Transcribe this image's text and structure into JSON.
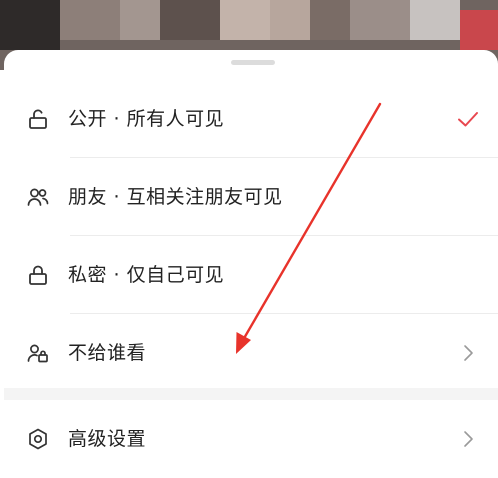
{
  "sheet": {
    "privacy_options": [
      {
        "label": "公开 · 所有人可见",
        "icon": "unlocked-icon",
        "selected": true
      },
      {
        "label": "朋友 · 互相关注朋友可见",
        "icon": "friends-icon",
        "selected": false
      },
      {
        "label": "私密 · 仅自己可见",
        "icon": "locked-icon",
        "selected": false
      },
      {
        "label": "不给谁看",
        "icon": "user-blocked-icon",
        "selected": false,
        "has_submenu": true
      }
    ],
    "advanced_settings": {
      "label": "高级设置",
      "icon": "settings-icon",
      "has_submenu": true
    }
  },
  "colors": {
    "check": "#e8474f",
    "annotation_arrow": "#e8332b",
    "text": "#222222",
    "icon": "#333333",
    "chevron": "#9a9a9a"
  }
}
